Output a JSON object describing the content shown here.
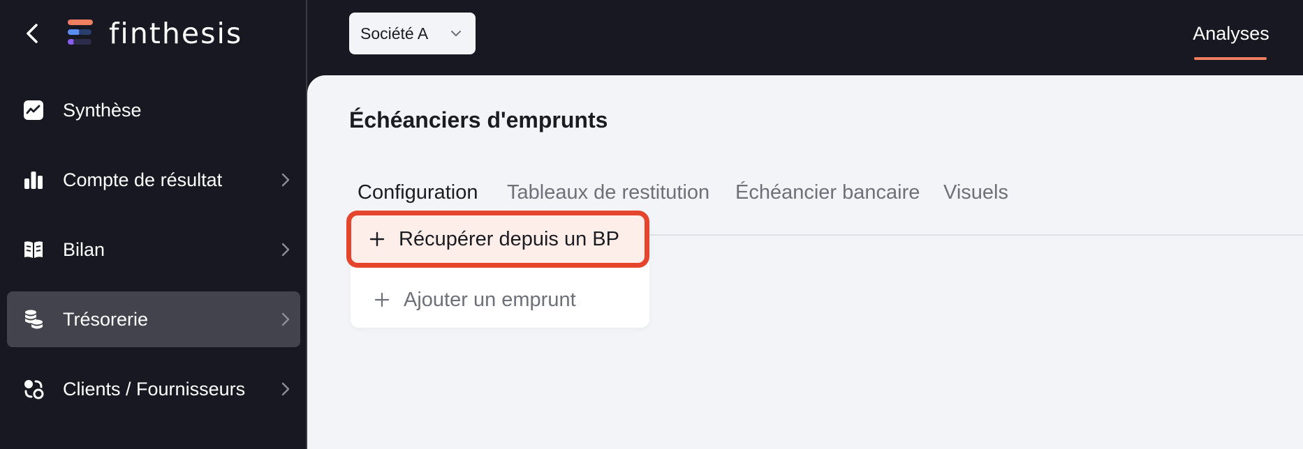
{
  "brand": {
    "name": "finthesis",
    "colors": {
      "accent": "#f07e60",
      "highlight_border": "#e5452c",
      "highlight_bg": "#fdeeea"
    }
  },
  "sidebar": {
    "back_icon": "chevron-left-icon",
    "items": [
      {
        "label": "Synthèse",
        "icon": "chart-line-icon",
        "has_chevron": false,
        "active": false
      },
      {
        "label": "Compte de résultat",
        "icon": "bar-chart-icon",
        "has_chevron": true,
        "active": false
      },
      {
        "label": "Bilan",
        "icon": "book-icon",
        "has_chevron": true,
        "active": false
      },
      {
        "label": "Trésorerie",
        "icon": "coins-stack-icon",
        "has_chevron": true,
        "active": true
      },
      {
        "label": "Clients / Fournisseurs",
        "icon": "exchange-icon",
        "has_chevron": true,
        "active": false
      }
    ]
  },
  "topbar": {
    "company_select": {
      "value": "Société A"
    },
    "tabs": [
      {
        "label": "Analyses",
        "active": true
      }
    ]
  },
  "main": {
    "title": "Échéanciers d'emprunts",
    "tabs": [
      {
        "label": "Configuration",
        "active": true
      },
      {
        "label": "Tableaux de restitution",
        "active": false
      },
      {
        "label": "Échéancier bancaire",
        "active": false
      },
      {
        "label": "Visuels",
        "active": false
      }
    ],
    "dropdown": {
      "items": [
        {
          "label": "Récupérer depuis un BP",
          "icon": "plus-icon",
          "highlighted": true
        },
        {
          "label": "Ajouter un emprunt",
          "icon": "plus-icon",
          "highlighted": false
        }
      ]
    }
  }
}
